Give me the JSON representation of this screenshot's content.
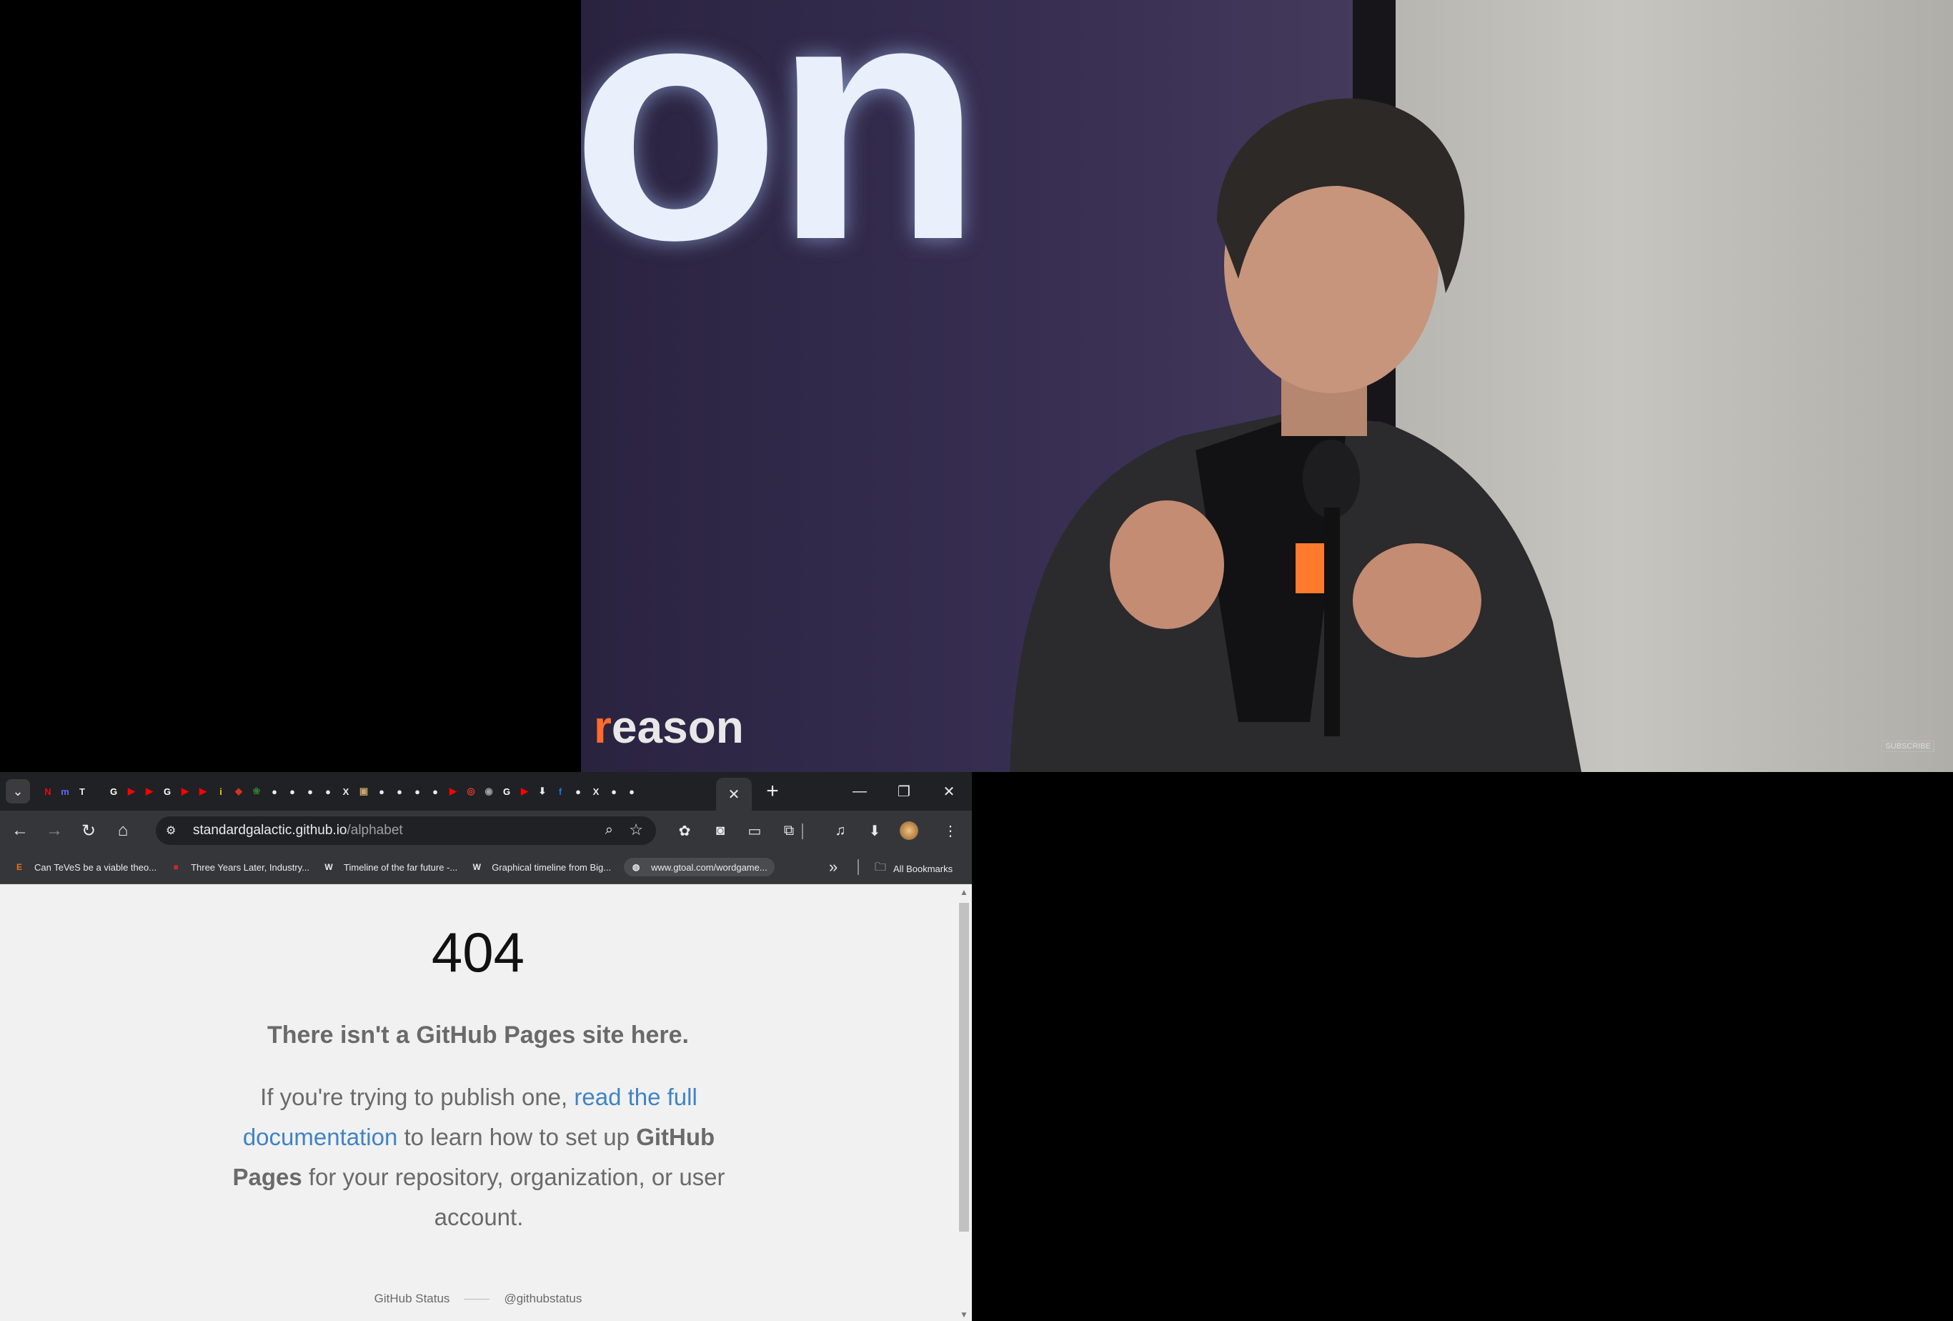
{
  "video": {
    "logo_fragment": "on",
    "watermark_r": "r",
    "watermark_rest": "eason",
    "subscribe_label": "SUBSCRIBE"
  },
  "browser": {
    "tabs": {
      "active_close": "✕",
      "new_tab": "+",
      "favicons": [
        {
          "icon": "google-icon",
          "glyph": "G",
          "color": "#ffffff"
        },
        {
          "icon": "youtube-icon",
          "glyph": "▶",
          "color": "#ff0000"
        },
        {
          "icon": "youtube-icon",
          "glyph": "▶",
          "color": "#ff0000"
        },
        {
          "icon": "google-icon",
          "glyph": "G",
          "color": "#ffffff"
        },
        {
          "icon": "youtube-icon",
          "glyph": "▶",
          "color": "#ff0000"
        },
        {
          "icon": "youtube-icon",
          "glyph": "▶",
          "color": "#ff0000"
        },
        {
          "icon": "imdb-icon",
          "glyph": "i",
          "color": "#f5c518"
        },
        {
          "icon": "cube-icon",
          "glyph": "◆",
          "color": "#d93025"
        },
        {
          "icon": "leaf-icon",
          "glyph": "❀",
          "color": "#2e7d32"
        },
        {
          "icon": "github-icon",
          "glyph": "●",
          "color": "#e8eaed"
        },
        {
          "icon": "github-icon",
          "glyph": "●",
          "color": "#e8eaed"
        },
        {
          "icon": "github-icon",
          "glyph": "●",
          "color": "#e8eaed"
        },
        {
          "icon": "github-icon",
          "glyph": "●",
          "color": "#e8eaed"
        },
        {
          "icon": "x-icon",
          "glyph": "X",
          "color": "#e8eaed"
        },
        {
          "icon": "image-icon",
          "glyph": "▣",
          "color": "#c9a66b"
        },
        {
          "icon": "github-icon",
          "glyph": "●",
          "color": "#e8eaed"
        },
        {
          "icon": "github-icon",
          "glyph": "●",
          "color": "#e8eaed"
        },
        {
          "icon": "github-icon",
          "glyph": "●",
          "color": "#e8eaed"
        },
        {
          "icon": "github-icon",
          "glyph": "●",
          "color": "#e8eaed"
        },
        {
          "icon": "youtube-icon",
          "glyph": "▶",
          "color": "#ff0000"
        },
        {
          "icon": "target-icon",
          "glyph": "◎",
          "color": "#e53935"
        },
        {
          "icon": "globe-icon",
          "glyph": "◉",
          "color": "#9aa0a6"
        },
        {
          "icon": "google-icon",
          "glyph": "G",
          "color": "#ffffff"
        },
        {
          "icon": "youtube-icon",
          "glyph": "▶",
          "color": "#ff0000"
        },
        {
          "icon": "download-icon",
          "glyph": "⬇",
          "color": "#e8eaed"
        },
        {
          "icon": "facebook-icon",
          "glyph": "f",
          "color": "#1877f2"
        },
        {
          "icon": "github-icon",
          "glyph": "●",
          "color": "#e8eaed"
        },
        {
          "icon": "x-icon",
          "glyph": "X",
          "color": "#e8eaed"
        },
        {
          "icon": "github-icon",
          "glyph": "●",
          "color": "#e8eaed"
        },
        {
          "icon": "github-icon",
          "glyph": "●",
          "color": "#e8eaed"
        }
      ],
      "pinned": [
        {
          "icon": "netflix-icon",
          "glyph": "N",
          "color": "#e50914"
        },
        {
          "icon": "mastodon-icon",
          "glyph": "m",
          "color": "#6364ff"
        },
        {
          "icon": "book-icon",
          "glyph": "T",
          "color": "#e8eaed"
        }
      ]
    },
    "toolbar": {
      "url_host": "standardgalactic.github.io",
      "url_path": "/alphabet"
    },
    "bookmarks": [
      {
        "label": "Can TeVeS be a viable theo...",
        "icon": "E",
        "icon_color": "#e8711a"
      },
      {
        "label": "Three Years Later, Industry...",
        "icon": "■",
        "icon_color": "#c62828"
      },
      {
        "label": "Timeline of the far future -...",
        "icon": "W",
        "icon_color": "#e8eaed"
      },
      {
        "label": "Graphical timeline from Big...",
        "icon": "W",
        "icon_color": "#e8eaed"
      },
      {
        "label": "www.gtoal.com/wordgame...",
        "icon": "◍",
        "icon_color": "#e8eaed"
      }
    ],
    "all_bookmarks_label": "All Bookmarks",
    "more_bookmarks": "»"
  },
  "page": {
    "code": "404",
    "heading": "There isn't a GitHub Pages site here.",
    "text_before": "If you're trying to publish one, ",
    "link_text": "read the full documentation",
    "text_middle": " to learn how to set up ",
    "bold_text": "GitHub Pages",
    "text_after": " for your repository, organization, or user account.",
    "footer_status": "GitHub Status",
    "footer_twitter": "@githubstatus"
  }
}
